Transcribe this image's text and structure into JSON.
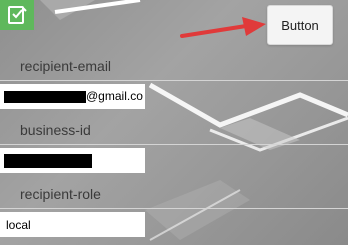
{
  "button": {
    "label": "Button"
  },
  "fields": [
    {
      "label": "recipient-email",
      "value": "@gmail.co",
      "redacted": true
    },
    {
      "label": "business-id",
      "value": "",
      "redacted": true
    },
    {
      "label": "recipient-role",
      "value": "local",
      "redacted": false
    }
  ],
  "colors": {
    "logo_bg": "#5fb85c",
    "arrow": "#e03a3a",
    "button_bg": "#f4f4f4",
    "input_bg": "#ffffff"
  },
  "icons": {
    "logo": "book-logo-icon",
    "annotation": "red-arrow-icon"
  }
}
